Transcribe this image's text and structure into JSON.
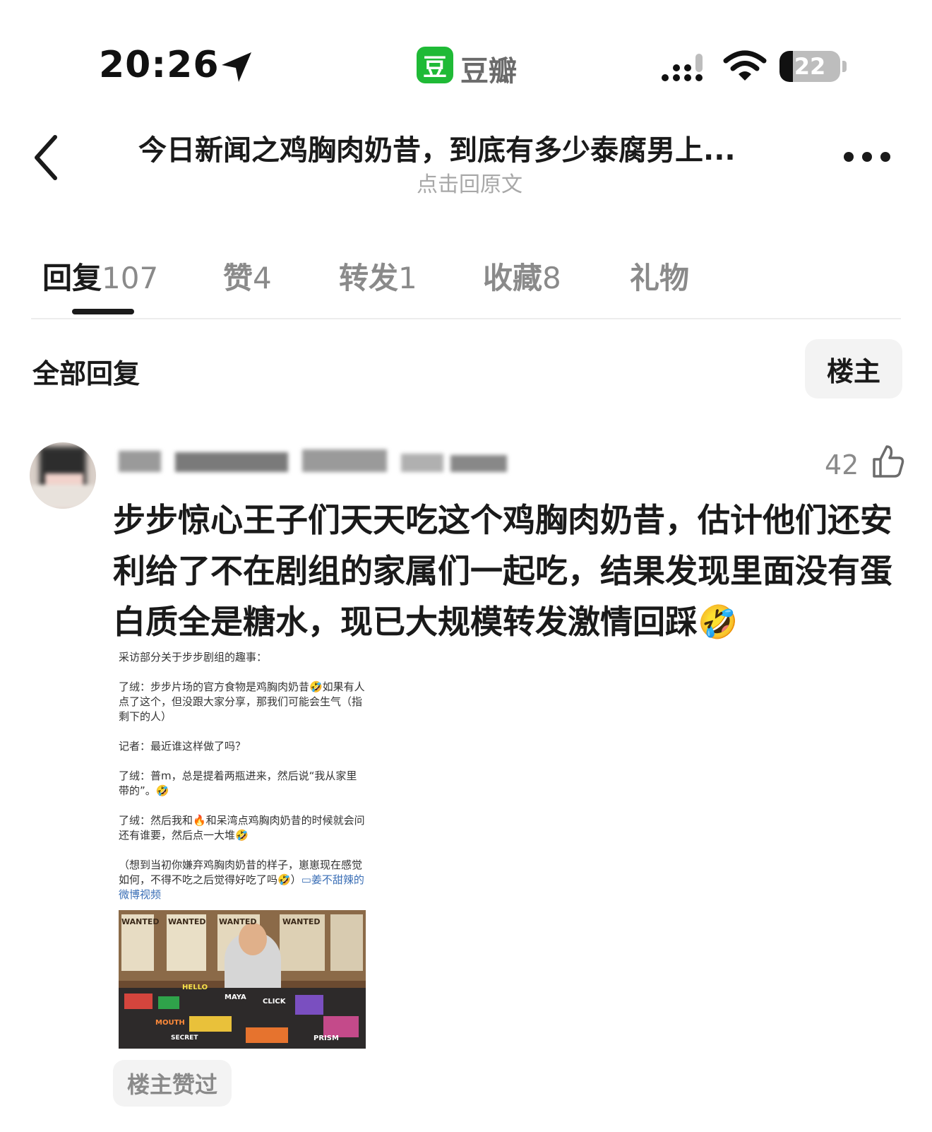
{
  "status_bar": {
    "time": "20:26",
    "app_badge": "豆",
    "app_name": "豆瓣",
    "battery_level": "22",
    "battery_fraction": 0.22
  },
  "nav": {
    "title": "今日新闻之鸡胸肉奶昔，到底有多少泰腐男上...",
    "subtitle": "点击回原文"
  },
  "tabs": [
    {
      "label": "回复",
      "count": "107",
      "active": true
    },
    {
      "label": "赞",
      "count": "4"
    },
    {
      "label": "转发",
      "count": "1"
    },
    {
      "label": "收藏",
      "count": "8"
    },
    {
      "label": "礼物",
      "count": ""
    }
  ],
  "section": {
    "title": "全部回复",
    "filter_label": "楼主"
  },
  "comment": {
    "like_count": "42",
    "text": "步步惊心王子们天天吃这个鸡胸肉奶昔，估计他们还安利给了不在剧组的家属们一起吃，结果发现里面没有蛋白质全是糖水，现已大规模转发激情回踩🤣",
    "embed": {
      "text": "采访部分关于步步剧组的趣事：\n\n了绒：步步片场的官方食物是鸡胸肉奶昔🤣如果有人点了这个，但没跟大家分享，那我们可能会生气（指剩下的人）\n\n记者：最近谁这样做了吗？\n\n了绒：普m，总是提着两瓶进来，然后说“我从家里带的”。🤣\n\n了绒：然后我和🔥和呆湾点鸡胸肉奶昔的时候就会问还有谁要，然后点一大堆🤣\n\n（想到当初你嫌弃鸡胸肉奶昔的样子，崽崽现在感觉如何，不得不吃之后觉得好吃了吗🤣）",
      "link_text": "姜不甜辣的微博视频",
      "image_labels": [
        "WANTED",
        "WANTED",
        "WANTED",
        "WANTED",
        "MAYA",
        "HELLO",
        "CLICK",
        "MOUTH",
        "SECRET",
        "PRISM"
      ]
    },
    "op_liked_badge": "楼主赞过"
  }
}
